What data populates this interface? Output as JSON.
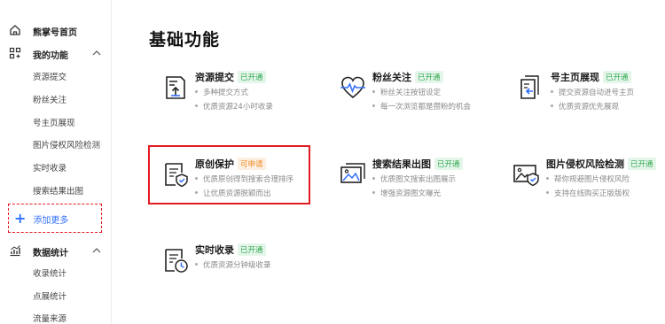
{
  "sidebar": {
    "home_label": "熊掌号首页",
    "my_functions": {
      "label": "我的功能",
      "items": [
        "资源提交",
        "粉丝关注",
        "号主页展现",
        "图片侵权风险检测",
        "实时收录",
        "搜索结果出图"
      ]
    },
    "add_more_label": "添加更多",
    "data_stats": {
      "label": "数据统计",
      "items": [
        "收录统计",
        "点展统计",
        "流量来源"
      ]
    }
  },
  "main": {
    "title": "基础功能",
    "cards": [
      {
        "name": "资源提交",
        "badge": "已开通",
        "status": "open",
        "icon": "document-upload-icon",
        "desc": [
          "多种提交方式",
          "优质资源24小时收录"
        ]
      },
      {
        "name": "粉丝关注",
        "badge": "已开通",
        "status": "open",
        "icon": "heart-pulse-icon",
        "desc": [
          "粉丝关注按钮设定",
          "每一次浏览都是攒粉的机会"
        ]
      },
      {
        "name": "号主页展现",
        "badge": "已开通",
        "status": "open",
        "icon": "pages-return-icon",
        "desc": [
          "提交资源自动进号主页",
          "优质资源优先展现"
        ]
      },
      {
        "name": "原创保护",
        "badge": "可申请",
        "status": "apply",
        "icon": "document-shield-icon",
        "desc": [
          "优质原创得到搜索合理排序",
          "让优质资源脱颖而出"
        ]
      },
      {
        "name": "搜索结果出图",
        "badge": "已开通",
        "status": "open",
        "icon": "image-stack-icon",
        "desc": [
          "优质图文搜索出图展示",
          "增强资源图文曝光"
        ]
      },
      {
        "name": "图片侵权风险检测",
        "badge": "已开通",
        "status": "open",
        "icon": "image-shield-icon",
        "desc": [
          "帮你规避图片侵权风险",
          "支持在线购买正版版权"
        ]
      },
      {
        "name": "实时收录",
        "badge": "已开通",
        "status": "open",
        "icon": "document-clock-icon",
        "desc": [
          "优质资源分钟级收录"
        ]
      }
    ]
  },
  "colors": {
    "accent_blue": "#3370ff",
    "highlight_red": "#e31b23",
    "badge_green": "#33a852",
    "badge_orange": "#f08a24"
  }
}
